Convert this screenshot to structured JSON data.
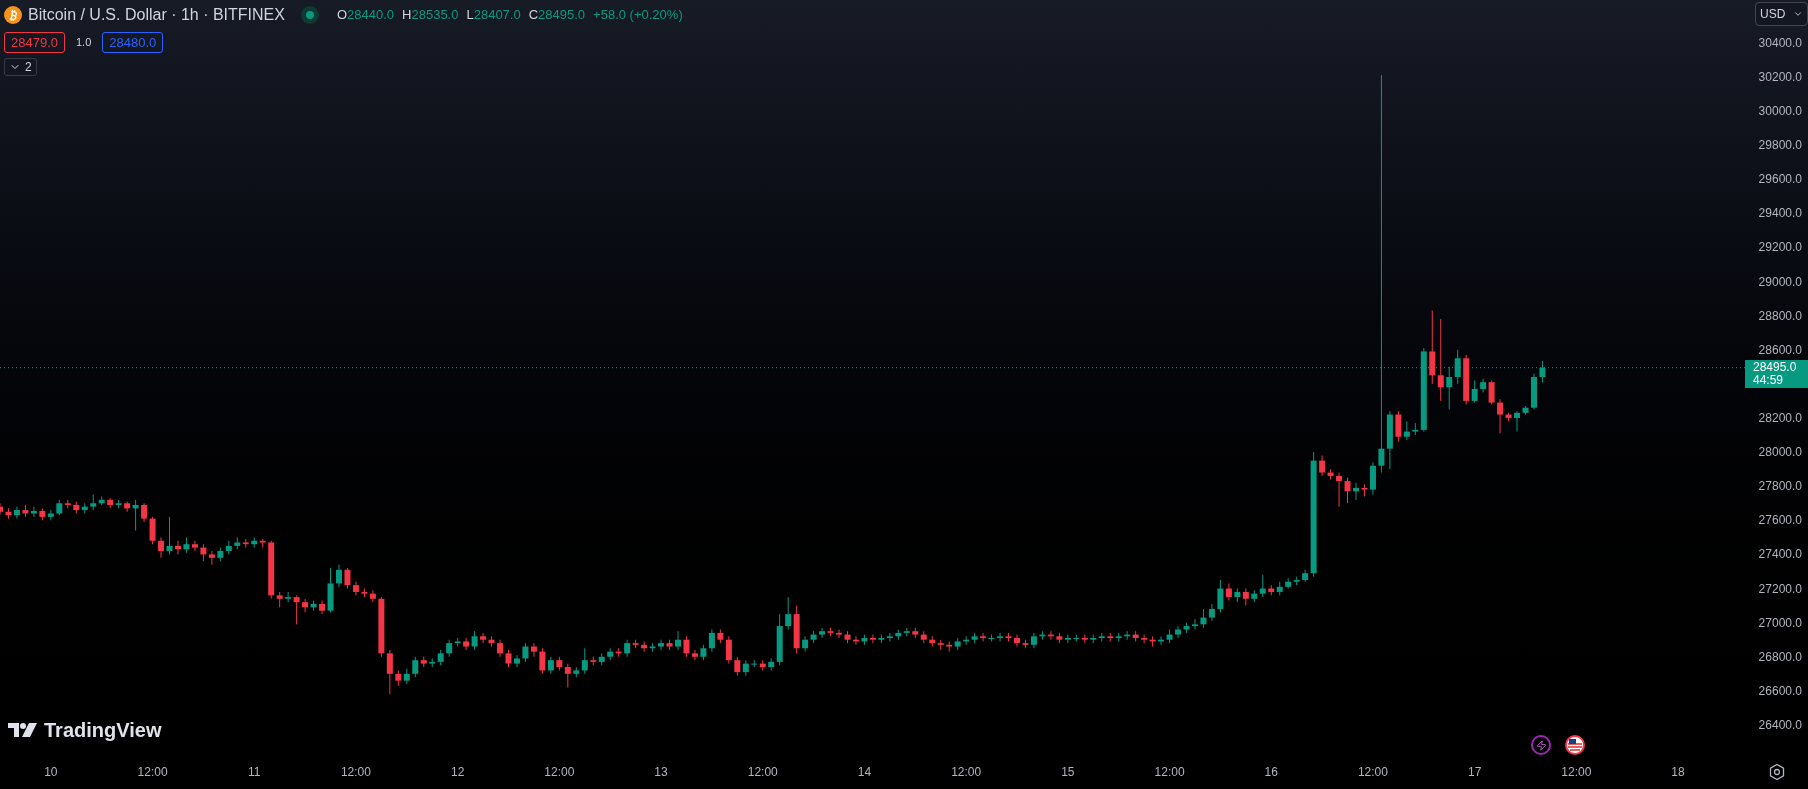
{
  "legend": {
    "title": "Bitcoin / U.S. Dollar · 1h · BITFINEX",
    "ohlc": [
      {
        "label": "O",
        "value": "28440.0"
      },
      {
        "label": "H",
        "value": "28535.0"
      },
      {
        "label": "L",
        "value": "28407.0"
      },
      {
        "label": "C",
        "value": "28495.0"
      }
    ],
    "change": "+58.0 (+0.20%)",
    "sell_price": "28479.0",
    "spread": "1.0",
    "buy_price": "28480.0",
    "collapse_count": "2"
  },
  "currency": "USD",
  "last_price": {
    "countdown": "44:59"
  },
  "logo_text": "TradingView",
  "chart_data": {
    "type": "candlestick",
    "yticks": [
      {
        "value": 26400,
        "label": "26400.0"
      },
      {
        "value": 26600,
        "label": "26600.0"
      },
      {
        "value": 26800,
        "label": "26800.0"
      },
      {
        "value": 27000,
        "label": "27000.0"
      },
      {
        "value": 27200,
        "label": "27200.0"
      },
      {
        "value": 27400,
        "label": "27400.0"
      },
      {
        "value": 27600,
        "label": "27600.0"
      },
      {
        "value": 27800,
        "label": "27800.0"
      },
      {
        "value": 28000,
        "label": "28000.0"
      },
      {
        "value": 28200,
        "label": "28200.0"
      },
      {
        "value": 28600,
        "label": "28600.0"
      },
      {
        "value": 28800,
        "label": "28800.0"
      },
      {
        "value": 29000,
        "label": "29000.0"
      },
      {
        "value": 29200,
        "label": "29200.0"
      },
      {
        "value": 29400,
        "label": "29400.0"
      },
      {
        "value": 29600,
        "label": "29600.0"
      },
      {
        "value": 29800,
        "label": "29800.0"
      },
      {
        "value": 30000,
        "label": "30000.0"
      },
      {
        "value": 30200,
        "label": "30200.0"
      },
      {
        "value": 30400,
        "label": "30400.0"
      }
    ],
    "ylim": [
      26400,
      30400
    ],
    "ref_lines": [
      {
        "axis": "y",
        "value": 28495,
        "label": "28495.0"
      }
    ],
    "categories": [
      null,
      null,
      null,
      null,
      null,
      null,
      "10",
      null,
      null,
      null,
      null,
      null,
      null,
      null,
      null,
      null,
      null,
      null,
      "12:00",
      null,
      null,
      null,
      null,
      null,
      null,
      null,
      null,
      null,
      null,
      null,
      "11",
      null,
      null,
      null,
      null,
      null,
      null,
      null,
      null,
      null,
      null,
      null,
      "12:00",
      null,
      null,
      null,
      null,
      null,
      null,
      null,
      null,
      null,
      null,
      null,
      "12",
      null,
      null,
      null,
      null,
      null,
      null,
      null,
      null,
      null,
      null,
      null,
      "12:00",
      null,
      null,
      null,
      null,
      null,
      null,
      null,
      null,
      null,
      null,
      null,
      "13",
      null,
      null,
      null,
      null,
      null,
      null,
      null,
      null,
      null,
      null,
      null,
      "12:00",
      null,
      null,
      null,
      null,
      null,
      null,
      null,
      null,
      null,
      null,
      null,
      "14",
      null,
      null,
      null,
      null,
      null,
      null,
      null,
      null,
      null,
      null,
      null,
      "12:00",
      null,
      null,
      null,
      null,
      null,
      null,
      null,
      null,
      null,
      null,
      null,
      "15",
      null,
      null,
      null,
      null,
      null,
      null,
      null,
      null,
      null,
      null,
      null,
      "12:00",
      null,
      null,
      null,
      null,
      null,
      null,
      null,
      null,
      null,
      null,
      null,
      "16",
      null,
      null,
      null,
      null,
      null,
      null,
      null,
      null,
      null,
      null,
      null,
      "12:00",
      null,
      null,
      null,
      null,
      null,
      null,
      null,
      null,
      null,
      null,
      null,
      "17",
      null,
      null,
      null,
      null,
      null,
      null,
      null,
      null,
      null,
      null,
      null,
      "12:00",
      null,
      null,
      null,
      null,
      null,
      null,
      null,
      null,
      null,
      null,
      null,
      "18",
      null,
      null,
      null,
      null,
      null,
      null,
      null,
      null
    ],
    "ohlc": [
      [
        27680,
        27700,
        27630,
        27650
      ],
      [
        27650,
        27670,
        27610,
        27630
      ],
      [
        27630,
        27680,
        27610,
        27660
      ],
      [
        27660,
        27690,
        27620,
        27640
      ],
      [
        27640,
        27680,
        27620,
        27655
      ],
      [
        27655,
        27670,
        27600,
        27620
      ],
      [
        27620,
        27660,
        27600,
        27640
      ],
      [
        27640,
        27720,
        27630,
        27700
      ],
      [
        27700,
        27720,
        27670,
        27690
      ],
      [
        27690,
        27710,
        27640,
        27660
      ],
      [
        27660,
        27700,
        27640,
        27680
      ],
      [
        27680,
        27750,
        27660,
        27700
      ],
      [
        27700,
        27740,
        27690,
        27720
      ],
      [
        27720,
        27730,
        27670,
        27690
      ],
      [
        27690,
        27720,
        27670,
        27700
      ],
      [
        27700,
        27710,
        27650,
        27670
      ],
      [
        27670,
        27720,
        27540,
        27690
      ],
      [
        27690,
        27700,
        27590,
        27610
      ],
      [
        27610,
        27620,
        27460,
        27480
      ],
      [
        27480,
        27500,
        27380,
        27420
      ],
      [
        27420,
        27620,
        27400,
        27450
      ],
      [
        27450,
        27480,
        27400,
        27430
      ],
      [
        27430,
        27500,
        27410,
        27460
      ],
      [
        27460,
        27480,
        27420,
        27440
      ],
      [
        27440,
        27460,
        27360,
        27400
      ],
      [
        27400,
        27420,
        27340,
        27380
      ],
      [
        27380,
        27440,
        27360,
        27420
      ],
      [
        27420,
        27480,
        27400,
        27450
      ],
      [
        27450,
        27500,
        27430,
        27470
      ],
      [
        27470,
        27490,
        27440,
        27460
      ],
      [
        27460,
        27500,
        27440,
        27480
      ],
      [
        27480,
        27490,
        27440,
        27470
      ],
      [
        27470,
        27480,
        27140,
        27160
      ],
      [
        27160,
        27180,
        27090,
        27140
      ],
      [
        27140,
        27180,
        27120,
        27150
      ],
      [
        27150,
        27160,
        26990,
        27120
      ],
      [
        27120,
        27140,
        27060,
        27090
      ],
      [
        27090,
        27130,
        27070,
        27110
      ],
      [
        27110,
        27130,
        27050,
        27070
      ],
      [
        27070,
        27320,
        27060,
        27230
      ],
      [
        27230,
        27340,
        27210,
        27310
      ],
      [
        27310,
        27320,
        27200,
        27220
      ],
      [
        27220,
        27240,
        27160,
        27180
      ],
      [
        27180,
        27200,
        27150,
        27170
      ],
      [
        27170,
        27190,
        27120,
        27140
      ],
      [
        27140,
        27150,
        26800,
        26820
      ],
      [
        26820,
        26840,
        26580,
        26700
      ],
      [
        26700,
        26720,
        26630,
        26660
      ],
      [
        26660,
        26730,
        26640,
        26700
      ],
      [
        26700,
        26800,
        26680,
        26780
      ],
      [
        26780,
        26800,
        26740,
        26760
      ],
      [
        26760,
        26790,
        26740,
        26770
      ],
      [
        26770,
        26840,
        26750,
        26820
      ],
      [
        26820,
        26900,
        26800,
        26880
      ],
      [
        26880,
        26910,
        26860,
        26890
      ],
      [
        26890,
        26910,
        26840,
        26860
      ],
      [
        26860,
        26950,
        26840,
        26920
      ],
      [
        26920,
        26940,
        26880,
        26900
      ],
      [
        26900,
        26920,
        26860,
        26880
      ],
      [
        26880,
        26900,
        26800,
        26820
      ],
      [
        26820,
        26840,
        26740,
        26760
      ],
      [
        26760,
        26810,
        26740,
        26790
      ],
      [
        26790,
        26880,
        26770,
        26860
      ],
      [
        26860,
        26880,
        26800,
        26830
      ],
      [
        26830,
        26850,
        26700,
        26720
      ],
      [
        26720,
        26800,
        26700,
        26780
      ],
      [
        26780,
        26800,
        26720,
        26740
      ],
      [
        26740,
        26760,
        26620,
        26700
      ],
      [
        26700,
        26740,
        26680,
        26720
      ],
      [
        26720,
        26850,
        26700,
        26780
      ],
      [
        26780,
        26800,
        26750,
        26770
      ],
      [
        26770,
        26820,
        26750,
        26800
      ],
      [
        26800,
        26850,
        26780,
        26830
      ],
      [
        26830,
        26850,
        26800,
        26820
      ],
      [
        26820,
        26900,
        26800,
        26880
      ],
      [
        26880,
        26900,
        26850,
        26870
      ],
      [
        26870,
        26890,
        26830,
        26850
      ],
      [
        26850,
        26880,
        26830,
        26860
      ],
      [
        26860,
        26900,
        26840,
        26880
      ],
      [
        26880,
        26900,
        26840,
        26860
      ],
      [
        26860,
        26950,
        26840,
        26900
      ],
      [
        26900,
        26920,
        26800,
        26820
      ],
      [
        26820,
        26840,
        26780,
        26800
      ],
      [
        26800,
        26870,
        26780,
        26850
      ],
      [
        26850,
        26960,
        26830,
        26940
      ],
      [
        26940,
        26960,
        26880,
        26900
      ],
      [
        26900,
        26920,
        26760,
        26780
      ],
      [
        26780,
        26800,
        26690,
        26710
      ],
      [
        26710,
        26780,
        26690,
        26760
      ],
      [
        26760,
        26780,
        26740,
        26760
      ],
      [
        26760,
        26780,
        26720,
        26740
      ],
      [
        26740,
        26790,
        26720,
        26770
      ],
      [
        26770,
        27050,
        26750,
        26980
      ],
      [
        26980,
        27150,
        26960,
        27050
      ],
      [
        27050,
        27100,
        26820,
        26850
      ],
      [
        26850,
        26920,
        26830,
        26900
      ],
      [
        26900,
        26950,
        26880,
        26930
      ],
      [
        26930,
        26970,
        26910,
        26950
      ],
      [
        26950,
        26970,
        26920,
        26940
      ],
      [
        26940,
        26960,
        26910,
        26930
      ],
      [
        26930,
        26950,
        26880,
        26900
      ],
      [
        26900,
        26920,
        26870,
        26890
      ],
      [
        26890,
        26930,
        26870,
        26910
      ],
      [
        26910,
        26930,
        26880,
        26900
      ],
      [
        26900,
        26930,
        26880,
        26910
      ],
      [
        26910,
        26940,
        26890,
        26920
      ],
      [
        26920,
        26960,
        26900,
        26940
      ],
      [
        26940,
        26970,
        26920,
        26950
      ],
      [
        26950,
        26970,
        26910,
        26930
      ],
      [
        26930,
        26950,
        26880,
        26900
      ],
      [
        26900,
        26920,
        26860,
        26880
      ],
      [
        26880,
        26900,
        26840,
        26870
      ],
      [
        26870,
        26890,
        26830,
        26860
      ],
      [
        26860,
        26910,
        26840,
        26890
      ],
      [
        26890,
        26920,
        26870,
        26900
      ],
      [
        26900,
        26940,
        26880,
        26920
      ],
      [
        26920,
        26940,
        26890,
        26910
      ],
      [
        26910,
        26930,
        26890,
        26910
      ],
      [
        26910,
        26940,
        26890,
        26920
      ],
      [
        26920,
        26940,
        26890,
        26910
      ],
      [
        26910,
        26930,
        26860,
        26880
      ],
      [
        26880,
        26900,
        26850,
        26870
      ],
      [
        26870,
        26940,
        26850,
        26920
      ],
      [
        26920,
        26950,
        26900,
        26930
      ],
      [
        26930,
        26950,
        26900,
        26920
      ],
      [
        26920,
        26940,
        26880,
        26900
      ],
      [
        26900,
        26930,
        26880,
        26910
      ],
      [
        26910,
        26930,
        26890,
        26910
      ],
      [
        26910,
        26930,
        26880,
        26900
      ],
      [
        26900,
        26930,
        26880,
        26910
      ],
      [
        26910,
        26940,
        26890,
        26920
      ],
      [
        26920,
        26940,
        26890,
        26910
      ],
      [
        26910,
        26940,
        26890,
        26920
      ],
      [
        26920,
        26950,
        26900,
        26930
      ],
      [
        26930,
        26950,
        26890,
        26910
      ],
      [
        26910,
        26930,
        26880,
        26900
      ],
      [
        26900,
        26920,
        26860,
        26890
      ],
      [
        26890,
        26920,
        26870,
        26900
      ],
      [
        26900,
        26960,
        26880,
        26930
      ],
      [
        26930,
        26980,
        26910,
        26960
      ],
      [
        26960,
        27000,
        26940,
        26980
      ],
      [
        26980,
        27020,
        26960,
        26990
      ],
      [
        26990,
        27080,
        26970,
        27030
      ],
      [
        27030,
        27110,
        27010,
        27080
      ],
      [
        27080,
        27250,
        27060,
        27200
      ],
      [
        27200,
        27230,
        27130,
        27150
      ],
      [
        27150,
        27200,
        27120,
        27180
      ],
      [
        27180,
        27200,
        27100,
        27140
      ],
      [
        27140,
        27190,
        27120,
        27170
      ],
      [
        27170,
        27280,
        27150,
        27200
      ],
      [
        27200,
        27220,
        27160,
        27180
      ],
      [
        27180,
        27240,
        27160,
        27210
      ],
      [
        27210,
        27260,
        27200,
        27240
      ],
      [
        27240,
        27270,
        27220,
        27250
      ],
      [
        27250,
        27310,
        27240,
        27290
      ],
      [
        27290,
        28000,
        27270,
        27950
      ],
      [
        27950,
        27980,
        27860,
        27880
      ],
      [
        27880,
        27900,
        27840,
        27860
      ],
      [
        27860,
        27880,
        27680,
        27830
      ],
      [
        27830,
        27850,
        27700,
        27770
      ],
      [
        27770,
        27820,
        27720,
        27790
      ],
      [
        27790,
        27810,
        27740,
        27780
      ],
      [
        27780,
        27940,
        27750,
        27920
      ],
      [
        27920,
        30210,
        27880,
        28020
      ],
      [
        28020,
        28240,
        27900,
        28220
      ],
      [
        28220,
        28240,
        28060,
        28090
      ],
      [
        28090,
        28180,
        28070,
        28120
      ],
      [
        28120,
        28170,
        28100,
        28130
      ],
      [
        28130,
        28610,
        28120,
        28590
      ],
      [
        28590,
        28830,
        28400,
        28450
      ],
      [
        28450,
        28780,
        28300,
        28380
      ],
      [
        28380,
        28500,
        28250,
        28440
      ],
      [
        28440,
        28600,
        28400,
        28550
      ],
      [
        28550,
        28570,
        28280,
        28300
      ],
      [
        28300,
        28420,
        28290,
        28370
      ],
      [
        28370,
        28430,
        28350,
        28410
      ],
      [
        28410,
        28420,
        28280,
        28290
      ],
      [
        28290,
        28310,
        28110,
        28220
      ],
      [
        28220,
        28230,
        28180,
        28200
      ],
      [
        28200,
        28240,
        28120,
        28230
      ],
      [
        28230,
        28270,
        28220,
        28260
      ],
      [
        28260,
        28460,
        28250,
        28440
      ],
      [
        28440,
        28535,
        28407,
        28495
      ],
      null,
      null,
      null,
      null,
      null,
      null,
      null,
      null,
      null,
      null,
      null,
      null,
      null,
      null,
      null,
      null,
      null,
      null,
      null,
      null,
      null,
      null,
      null,
      null
    ]
  }
}
